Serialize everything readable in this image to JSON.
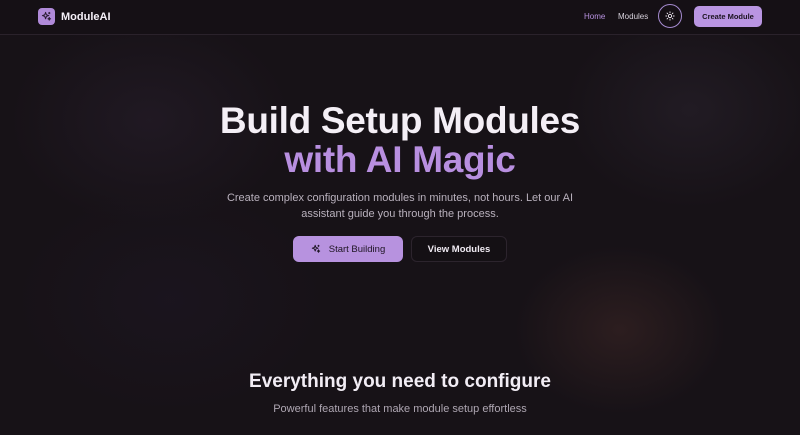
{
  "brand": {
    "name": "ModuleAI",
    "icon": "sparkles-icon"
  },
  "nav": {
    "links": [
      {
        "label": "Home",
        "active": true
      },
      {
        "label": "Modules",
        "active": false
      }
    ],
    "theme_toggle_icon": "sun-icon",
    "create_button": "Create Module"
  },
  "hero": {
    "title_line1": "Build Setup Modules",
    "title_line2": "with AI Magic",
    "subtitle": "Create complex configuration modules in minutes, not hours. Let our AI assistant guide you through the process.",
    "primary_button": {
      "label": "Start Building",
      "icon": "sparkles-icon"
    },
    "secondary_button": {
      "label": "View Modules"
    }
  },
  "features": {
    "title": "Everything you need to configure",
    "subtitle": "Powerful features that make module setup effortless"
  },
  "colors": {
    "accent": "#b792df",
    "background": "#171217",
    "text": "#f4eff6",
    "muted_text": "#b9b1bd"
  }
}
